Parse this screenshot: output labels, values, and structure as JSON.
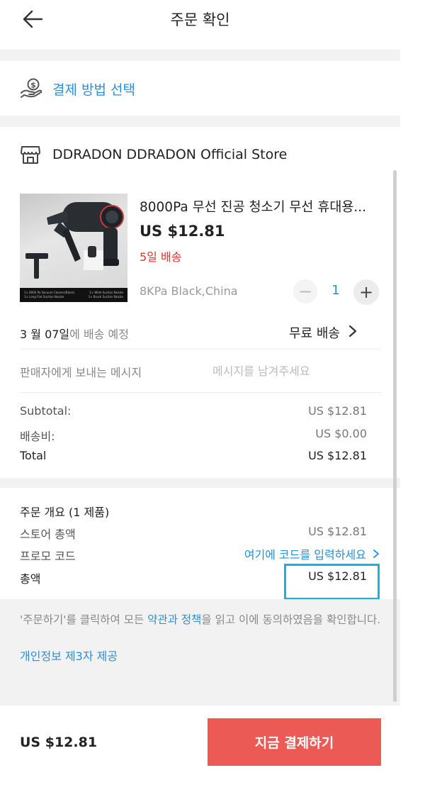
{
  "header": {
    "title": "주문 확인"
  },
  "payment": {
    "label": "결제 방법 선택"
  },
  "store": {
    "name": "DDRADON DDRADON Official Store"
  },
  "product": {
    "title": "8000Pa 무선 진공 청소기 무선 휴대용...",
    "price": "US $12.81",
    "shipping_time": "5일 배송",
    "variant": "8KPa Black,China",
    "quantity": "1",
    "image_captions": [
      "1× 8000 Pa Vacuum Cleaner(Black)",
      "1× Long Flat Suction Nozzle",
      "1× Wide Suction Nozzle",
      "1× Brush Suction Nozzle"
    ]
  },
  "delivery": {
    "date": "3 월 07일",
    "date_suffix": "에 배송 예정",
    "shipping_option": "무료 배송"
  },
  "message": {
    "label": "판매자에게 보내는 메시지",
    "placeholder": "메시지를 남겨주세요"
  },
  "summary": {
    "subtotal_label": "Subtotal:",
    "subtotal_value": "US $12.81",
    "shipping_label": "배송비:",
    "shipping_value": "US $0.00",
    "total_label": "Total",
    "total_value": "US $12.81"
  },
  "order_overview": {
    "title": "주문 개요 (1 제품)",
    "store_total_label": "스토어 총액",
    "store_total_value": "US $12.81",
    "promo_label": "프로모 코드",
    "promo_link": "여기에 코드를 입력하세요",
    "grand_total_label": "총액",
    "grand_total_value": "US $12.81"
  },
  "terms": {
    "prefix": "'주문하기'를 클릭하여 모든 ",
    "link": "약관과 정책",
    "suffix": "을 읽고 이에 동의하였음을 확인합니다.",
    "privacy_link": "개인정보 제3자 제공"
  },
  "bottom": {
    "total": "US $12.81",
    "pay_button": "지금 결제하기"
  },
  "colors": {
    "accent_blue": "#2b8fd6",
    "pay_button": "#ec5a55",
    "shipping_red": "#e0322f",
    "highlight_box": "#19b0e6"
  }
}
